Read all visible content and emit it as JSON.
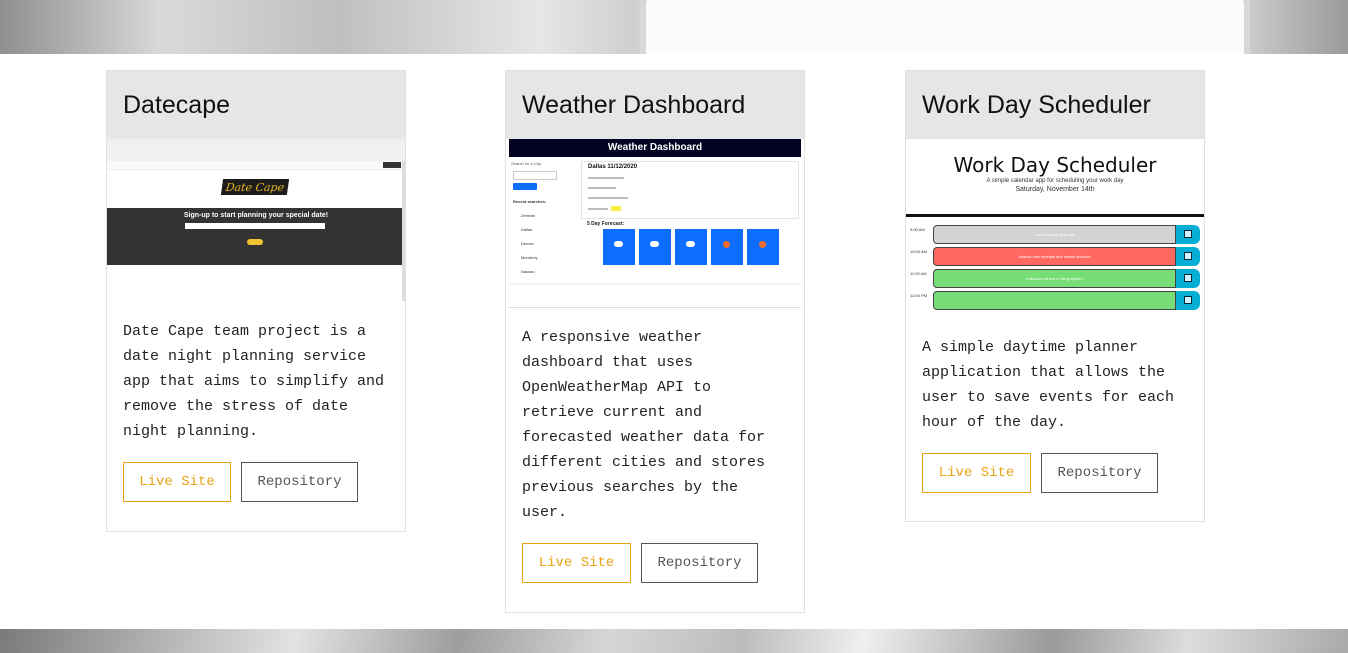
{
  "colors": {
    "header_bg": "#e6e6e6",
    "live_accent": "#e8a317",
    "repo_border": "#555555"
  },
  "projects": [
    {
      "title": "Datecape",
      "description": "Date Cape team project is a date night planning service app that aims to simplify and remove the stress of date night planning.",
      "live_label": "Live Site",
      "repo_label": "Repository",
      "thumb": {
        "logo": "Date Cape",
        "tagline": "Sign-up to start planning your special date!"
      }
    },
    {
      "title": "Weather Dashboard",
      "description": "A responsive weather dashboard that uses OpenWeatherMap API to retrieve current and forecasted weather data for different cities and stores previous searches by the user.",
      "live_label": "Live Site",
      "repo_label": "Repository",
      "thumb": {
        "header": "Weather Dashboard",
        "search_label": "Search for a City:",
        "search_placeholder": "City",
        "search_button": "Search",
        "recent_label": "Recent searches:",
        "recent": [
          "Zermatt",
          "Dallas",
          "Denver",
          "Monterey",
          "Nassau"
        ],
        "current_title": "Dallas  11/12/2020",
        "forecast_title": "5 Day Forecast:"
      }
    },
    {
      "title": "Work Day Scheduler",
      "description": "A simple daytime planner application that allows the user to save events for each hour of the day.",
      "live_label": "Live Site",
      "repo_label": "Repository",
      "thumb": {
        "title": "Work Day Scheduler",
        "subtitle": "A simple calendar app for scheduling your work day",
        "date": "Saturday, November 14th",
        "hours": [
          "9:00 AM",
          "10:00 AM",
          "11:00 AM",
          "12:00 PM"
        ],
        "rows": [
          {
            "text": "Lunch Friday Held Job",
            "color": "#d3d3d3"
          },
          {
            "text": "Assess new receipts and create invoices",
            "color": "#ff6961"
          },
          {
            "text": "Introduce others to filing system",
            "color": "#77dd77"
          },
          {
            "text": "",
            "color": "#77dd77"
          }
        ]
      }
    }
  ]
}
